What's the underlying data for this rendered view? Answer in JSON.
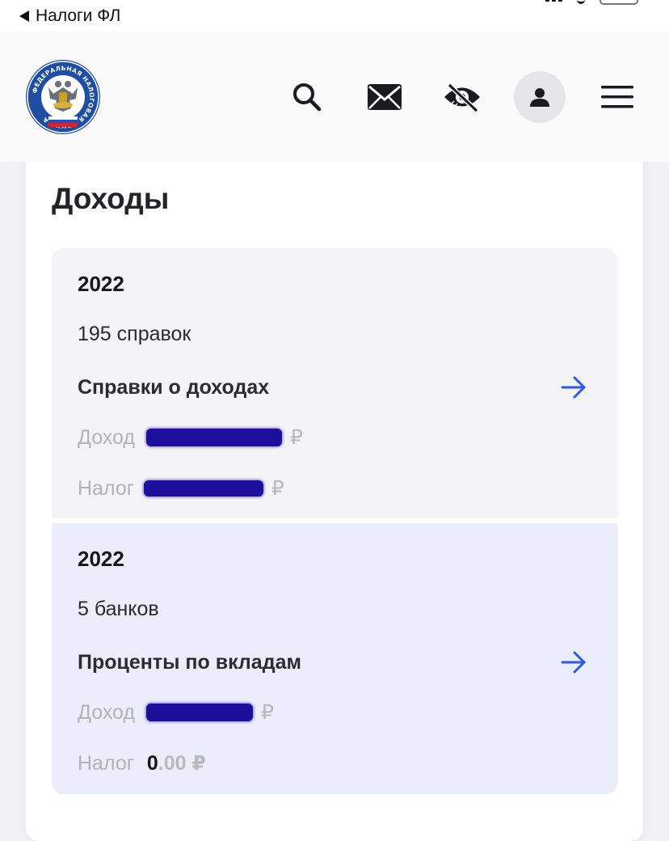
{
  "status_bar": {
    "back_label": "Налоги ФЛ"
  },
  "header": {
    "logo_text": "ФЕДЕРАЛЬНАЯ НАЛОГОВАЯ СЛУЖБА",
    "icons": [
      "search-icon",
      "mail-icon",
      "eye-off-icon",
      "person-icon",
      "menu-icon"
    ]
  },
  "card": {
    "title": "Доходы"
  },
  "tiles": [
    {
      "year": "2022",
      "count": "195 справок",
      "link_label": "Справки о доходах",
      "income_label": "Доход",
      "income_currency": "₽",
      "tax_label": "Налог",
      "tax_currency": "₽"
    },
    {
      "year": "2022",
      "count": "5 банков",
      "link_label": "Проценты по вкладам",
      "income_label": "Доход",
      "income_currency": "₽",
      "tax_label": "Налог",
      "tax_int": "0",
      "tax_dec": ".00 ₽"
    }
  ],
  "colors": {
    "accent_blue": "#2a5be8",
    "redaction": "#1d0f9c",
    "tile1_bg": "#f4f4f6",
    "tile2_bg": "#ebeefa"
  }
}
